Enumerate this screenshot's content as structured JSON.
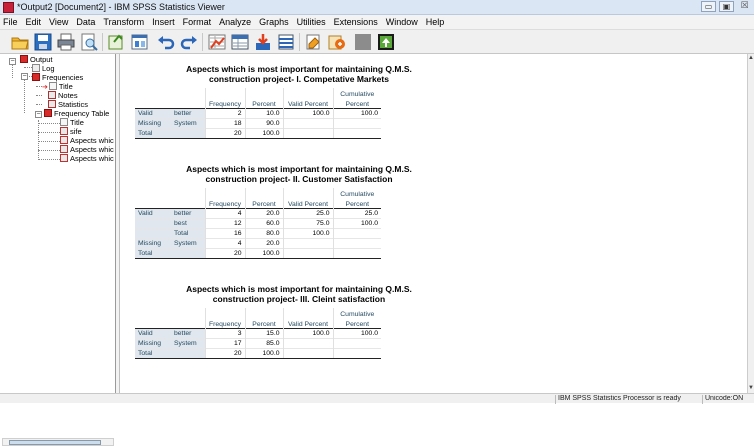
{
  "titlebar": {
    "title": "*Output2 [Document2] - IBM SPSS Statistics Viewer",
    "minimize": "▭",
    "restore": "▣",
    "close": "☒"
  },
  "menu": [
    "File",
    "Edit",
    "View",
    "Data",
    "Transform",
    "Insert",
    "Format",
    "Analyze",
    "Graphs",
    "Utilities",
    "Extensions",
    "Window",
    "Help"
  ],
  "toolbar_icons": [
    "open-folder-icon",
    "save-icon",
    "print-icon",
    "print-preview-icon",
    "export-icon",
    "recall-dialog-icon",
    "undo-icon",
    "redo-icon",
    "goto-data-icon",
    "goto-case-icon",
    "goto-variable-icon",
    "variables-icon",
    "designate-window-icon",
    "show-all-icon",
    "insert-output-icon",
    "promote-icon"
  ],
  "outline": {
    "items": [
      {
        "label": "Output",
        "icon": "output-book-icon"
      },
      {
        "label": "Log",
        "icon": "log-icon"
      },
      {
        "label": "Frequencies",
        "icon": "frequencies-book-icon"
      },
      {
        "label": "Title",
        "icon": "title-icon"
      },
      {
        "label": "Notes",
        "icon": "notes-icon"
      },
      {
        "label": "Statistics",
        "icon": "statistics-table-icon"
      },
      {
        "label": "Frequency Table",
        "icon": "frequency-book-icon"
      },
      {
        "label": "Title",
        "icon": "title-icon"
      },
      {
        "label": "sife",
        "icon": "table-icon"
      },
      {
        "label": "Aspects whic",
        "icon": "table-icon"
      },
      {
        "label": "Aspects whic",
        "icon": "table-icon"
      },
      {
        "label": "Aspects whic",
        "icon": "table-icon"
      }
    ]
  },
  "headers": {
    "frequency": "Frequency",
    "percent": "Percent",
    "valid_percent": "Valid Percent",
    "cumulative1": "Cumulative",
    "cumulative2": "Percent"
  },
  "tables": [
    {
      "title1": "Aspects which is most important for maintaining Q.M.S.",
      "title2": "construction project- I. Competative Markets",
      "rows": [
        {
          "g": "Valid",
          "c": "better",
          "f": "2",
          "p": "10.0",
          "vp": "100.0",
          "cp": "100.0"
        },
        {
          "g": "Missing",
          "c": "System",
          "f": "18",
          "p": "90.0",
          "vp": "",
          "cp": ""
        },
        {
          "g": "Total",
          "c": "",
          "f": "20",
          "p": "100.0",
          "vp": "",
          "cp": ""
        }
      ]
    },
    {
      "title1": "Aspects which is most important for maintaining Q.M.S.",
      "title2": "construction project- II. Customer Satisfaction",
      "rows": [
        {
          "g": "Valid",
          "c": "better",
          "f": "4",
          "p": "20.0",
          "vp": "25.0",
          "cp": "25.0"
        },
        {
          "g": "",
          "c": "best",
          "f": "12",
          "p": "60.0",
          "vp": "75.0",
          "cp": "100.0"
        },
        {
          "g": "",
          "c": "Total",
          "f": "16",
          "p": "80.0",
          "vp": "100.0",
          "cp": ""
        },
        {
          "g": "Missing",
          "c": "System",
          "f": "4",
          "p": "20.0",
          "vp": "",
          "cp": ""
        },
        {
          "g": "Total",
          "c": "",
          "f": "20",
          "p": "100.0",
          "vp": "",
          "cp": ""
        }
      ]
    },
    {
      "title1": "Aspects which is most important for maintaining Q.M.S.",
      "title2": "construction project- III. Cleint satisfaction",
      "rows": [
        {
          "g": "Valid",
          "c": "better",
          "f": "3",
          "p": "15.0",
          "vp": "100.0",
          "cp": "100.0"
        },
        {
          "g": "Missing",
          "c": "System",
          "f": "17",
          "p": "85.0",
          "vp": "",
          "cp": ""
        },
        {
          "g": "Total",
          "c": "",
          "f": "20",
          "p": "100.0",
          "vp": "",
          "cp": ""
        }
      ]
    }
  ],
  "status": {
    "processor": "IBM SPSS Statistics Processor is ready",
    "encoding": "Unicode:ON"
  }
}
